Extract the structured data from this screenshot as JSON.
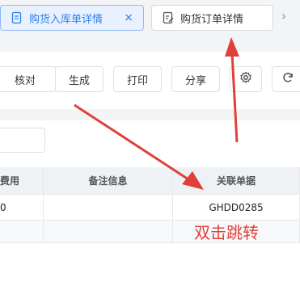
{
  "tabs": [
    {
      "label": "购货入库单详情",
      "active": true,
      "close": "×",
      "icon": "doc-icon"
    },
    {
      "label": "购货订单详情",
      "active": false,
      "icon": "doc-edit-icon"
    }
  ],
  "tabs_more": "›",
  "toolbar": {
    "partial_label": "核对",
    "generate_label": "生成",
    "print_label": "打印",
    "share_label": "分享",
    "settings_icon": "gear-icon",
    "refresh_icon": "refresh-icon"
  },
  "table": {
    "headers": [
      "费用",
      "备注信息",
      "关联单据"
    ],
    "rows": [
      [
        "0",
        "",
        "GHDD0285"
      ]
    ]
  },
  "annotation": "双击跳转",
  "colors": {
    "accent": "#2f7ef2",
    "annotation": "#e0403a"
  }
}
